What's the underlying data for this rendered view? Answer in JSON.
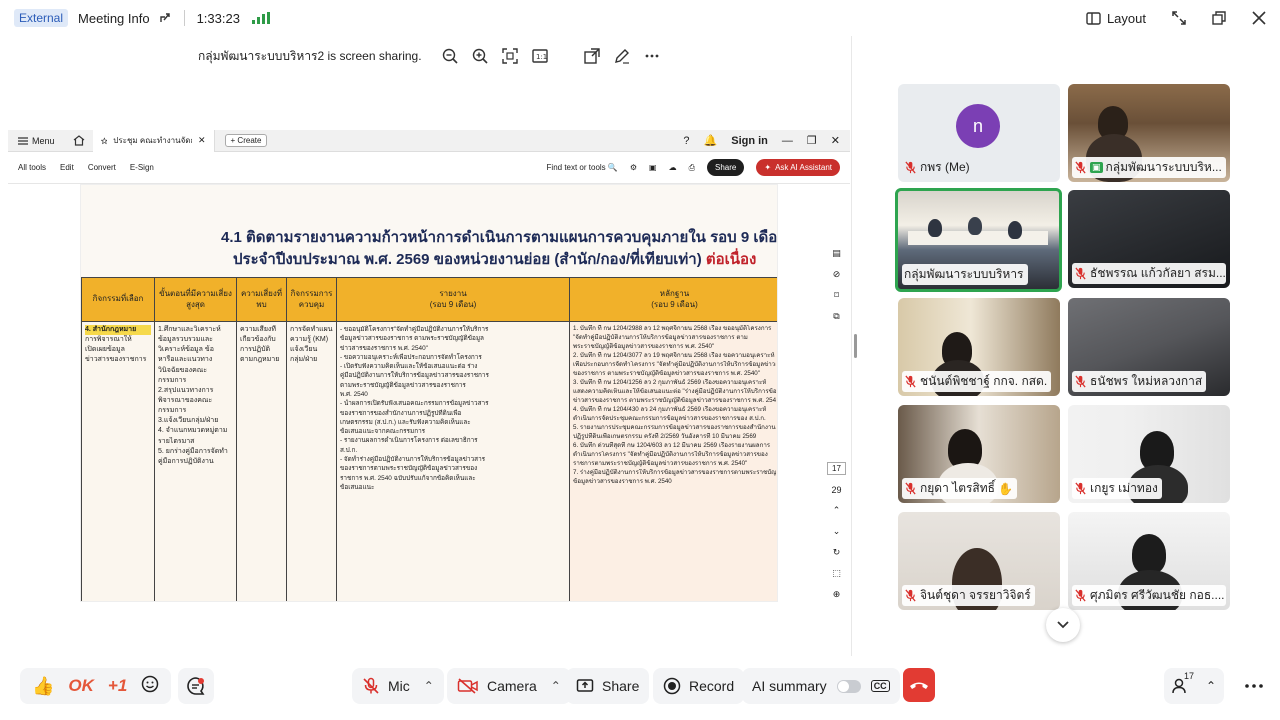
{
  "topbar": {
    "external_label": "External",
    "meeting_info_label": "Meeting Info",
    "timer": "1:33:23",
    "layout_label": "Layout"
  },
  "share_notice": {
    "text": "กลุ่มพัฒนาระบบบริหาร2 is screen sharing."
  },
  "pdf": {
    "menu_label": "Menu",
    "tab_title": "ประชุม คณะทำงานจัดการระบบ...",
    "create_label": "Create",
    "sign_in_label": "Sign in",
    "toolbar_items": [
      "All tools",
      "Edit",
      "Convert",
      "E-Sign"
    ],
    "find_label": "Find text or tools",
    "share_label": "Share",
    "ai_label": "Ask AI Assistant",
    "page_current": "17",
    "page_total": "29",
    "title_line1": "4.1 ติดตามรายงานความก้าวหน้าการดำเนินการตามแผนการควบคุมภายใน รอบ 9 เดือน",
    "title_line2_main": "ประจำปีงบประมาณ พ.ศ. 2569 ของหน่วยงานย่อย (สำนัก/กอง/ที่เทียบเท่า)",
    "title_line2_red": "ต่อเนื่อง",
    "headers": [
      "กิจกรรมที่เลือก",
      "ขั้นตอนที่มีความเสี่ยงสูงสุด",
      "ความเสี่ยงที่พบ",
      "กิจกรรมการควบคุม",
      "รายงาน\n(รอบ 9 เดือน)",
      "หลักฐาน\n(รอบ 9 เดือน)"
    ],
    "col1_highlight": "4. สำนักกฎหมาย",
    "col1_lines": [
      "การพิจารณาให้",
      "เปิดเผยข้อมูล",
      "ข่าวสารของราชการ"
    ],
    "col2_lines": [
      "1.ศึกษาและวิเคราะห์",
      "ข้อมูลรวบรวมและ",
      "วิเคราะห์ข้อมูล ข้อ",
      "หารือและแนวทาง",
      "วินิจฉัยของคณะ",
      "กรรมการ",
      "2.สรุปแนวทางการ",
      "พิจารณาของคณะ",
      "กรรมการ",
      "3.แจ้งเวียนกลุ่ม/ฝ่าย",
      "4. จำแนกหมวดหมู่ตาม",
      "รายไตรมาส",
      "5. ยกร่างคู่มือการจัดทำ",
      "คู่มือการปฏิบัติงาน"
    ],
    "col3_lines": [
      "ความเสี่ยงที่",
      "เกี่ยวข้องกับ",
      "การปฏิบัติ",
      "ตามกฎหมาย"
    ],
    "col4_lines": [
      "การจัดทำแผน",
      "ความรู้ (KM)",
      "แจ้งเวียน",
      "กลุ่ม/ฝ่าย"
    ],
    "col5_lines": [
      "- ขออนุมัติโครงการ\"จัดทำคู่มือปฏิบัติงานการให้บริการ",
      "ข้อมูลข่าวสารของราชการ ตามพระราชบัญญัติข้อมูล",
      "ข่าวสารของราชการ พ.ศ. 2540\"",
      "- ขอความอนุเคราะห์เพื่อประกอบการจัดทำโครงการ",
      "- เปิดรับฟังความคิดเห็นและให้ข้อเสนอแนะต่อ ร่าง",
      "คู่มือปฏิบัติงานการให้บริการข้อมูลข่าวสารของราชการ",
      "ตามพระราชบัญญัติข้อมูลข่าวสารของราชการ",
      "พ.ศ. 2540",
      "- นำผลการเปิดรับฟังเสนอคณะกรรมการข้อมูลข่าวสาร",
      "ของราชการของสำนักงานการปฏิรูปที่ดินเพื่อ",
      "เกษตรกรรม (ส.ป.ก.) และรับฟังความคิดเห็นและ",
      "ข้อเสนอแนะจากคณะกรรมการ",
      "- รายงานผลการดำเนินการโครงการ ต่อเลขาธิการ",
      "ส.ป.ก.",
      "- จัดทำร่างคู่มือปฏิบัติงานการให้บริการข้อมูลข่าวสาร",
      "ของราชการตามพระราชบัญญัติข้อมูลข่าวสารของ",
      "ราชการ พ.ศ. 2540 ฉบับปรับแก้จากข้อคิดเห็นและ",
      "ข้อเสนอแนะ"
    ],
    "col6_lines": [
      "1. บันทึก ที่ กษ 1204/2988 ลว 12 พฤศจิกายน 2568 เรื่อง ขออนุมัติโครงการ",
      "\"จัดทำคู่มือปฏิบัติงานการให้บริการข้อมูลข่าวสารของราชการ ตาม",
      "พระราชบัญญัติข้อมูลข่าวสารของราชการ พ.ศ. 2540\"",
      "2. บันทึก ที่ กษ 1204/3077 ลว 19 พฤศจิกายน 2568 เรื่อง ขอความอนุเคราะห์",
      "เพื่อประกอบการจัดทำโครงการ \"จัดทำคู่มือปฏิบัติงานการให้บริการข้อมูลข่าวสาร",
      "ของราชการ ตามพระราชบัญญัติข้อมูลข่าวสารของราชการ พ.ศ. 2540\"",
      "3. บันทึก ที่ กษ 1204/1256 ลว 2 กุมภาพันธ์ 2569 เรื่องขอความอนุเคราะห์",
      "แสดงความคิดเห็นและให้ข้อเสนอแนะต่อ \"ร่างคู่มือปฏิบัติงานการให้บริการข้อมูล",
      "ข่าวสารของราชการ ตามพระราชบัญญัติข้อมูลข่าวสารของราชการ พ.ศ. 2540\"",
      "4. บันทึก ที่ กษ 1204/430 ลว 24 กุมภาพันธ์ 2569 เรื่องขอความอนุเคราะห์",
      "ดำเนินการจัดประชุมคณะกรรมการข้อมูลข่าวสารของราชการของ ส.ป.ก.",
      "5. รายงานการประชุมคณะกรรมการข้อมูลข่าวสารของราชการของสำนักงาน",
      "ปฏิรูปที่ดินเพื่อเกษตรกรรม ครั้งที่ 2/2569 วันอังคารที่ 10 มีนาคม 2569",
      "6. บันทึก ด่วนที่สุดที่ กษ 1204/603 ลว 12 มีนาคม 2569 เรื่องรายงานผลการ",
      "ดำเนินการโครงการ \"จัดทำคู่มือปฏิบัติงานการให้บริการข้อมูลข่าวสารของ",
      "ราชการตามพระราชบัญญัติข้อมูลข่าวสารของราชการ พ.ศ. 2540\"",
      "7. ร่างคู่มือปฏิบัติงานการให้บริการข้อมูลข่าวสารของราชการตามพระราชบัญญัติ",
      "ข้อมูลข่าวสารของราชการ พ.ศ. 2540"
    ]
  },
  "participants": [
    {
      "name": "กพร (Me)",
      "avatar_letter": "n"
    },
    {
      "name": "กลุ่มพัฒนาระบบบริห..."
    },
    {
      "name": "กลุ่มพัฒนาระบบบริหาร"
    },
    {
      "name": "ธัชพรรณ แก้วกัลยา สรม...."
    },
    {
      "name": "ชนันต์พิชชาฐ์ กกจ. กสด."
    },
    {
      "name": "ธนัชพร ใหม่หลวงกาส"
    },
    {
      "name": "กยุดา ไตรสิทธิ์"
    },
    {
      "name": "เกยูร เม่าทอง"
    },
    {
      "name": "จินต์ชุดา จรรยาวิจิตร์"
    },
    {
      "name": "ศุภมิตร ศรีวัฒนชัย กอธ...."
    }
  ],
  "controls": {
    "ok_label": "OK",
    "plus_one_label": "+1",
    "mic_label": "Mic",
    "camera_label": "Camera",
    "share_label": "Share",
    "record_label": "Record",
    "ai_summary_label": "AI summary",
    "cc_label": "CC",
    "participant_count": "17"
  },
  "colors": {
    "accent_green": "#2ea44f",
    "hangup_red": "#e23b33",
    "table_header": "#f1b12a",
    "avatar_purple": "#7b3fb4"
  }
}
